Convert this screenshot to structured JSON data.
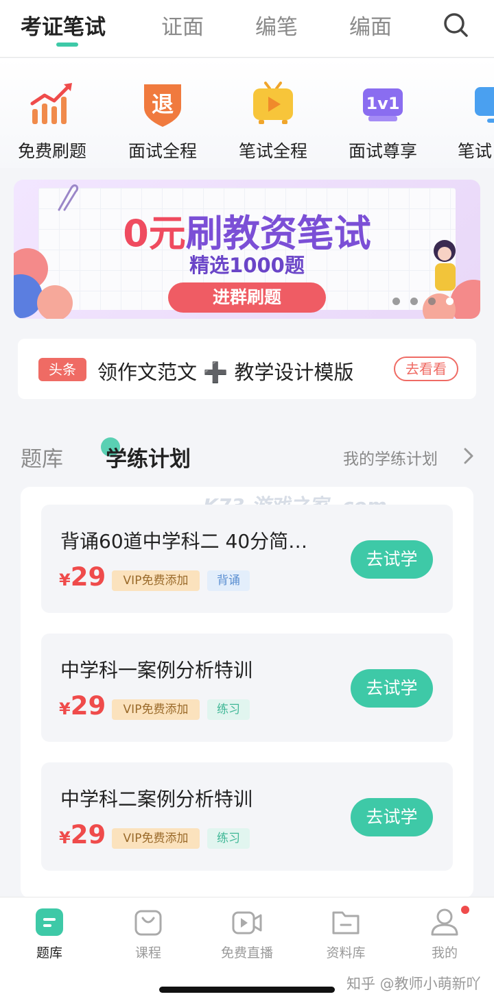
{
  "top_tabs": [
    "考证笔试",
    "证面",
    "编笔",
    "编面"
  ],
  "categories": [
    "免费刷题",
    "面试全程",
    "笔试全程",
    "面试尊享",
    "笔试"
  ],
  "category_icon_glyphs": {
    "refund": "退",
    "one_on_one": "1v1"
  },
  "banner": {
    "title_red": "0元",
    "title_purple": "刷教资笔试",
    "subtitle": "精选1000题",
    "button": "进群刷题"
  },
  "news": {
    "tag": "头条",
    "text": "领作文范文 ➕ 教学设计模版",
    "action": "去看看"
  },
  "sections": {
    "tab1": "题库",
    "tab2": "学练计划",
    "my_plan": "我的学练计划"
  },
  "plans": [
    {
      "title": "背诵60道中学科二 40分简…",
      "currency": "¥",
      "price": "29",
      "vip": "VIP免费添加",
      "kind": "背诵",
      "action": "去试学"
    },
    {
      "title": "中学科一案例分析特训",
      "currency": "¥",
      "price": "29",
      "vip": "VIP免费添加",
      "kind": "练习",
      "action": "去试学"
    },
    {
      "title": "中学科二案例分析特训",
      "currency": "¥",
      "price": "29",
      "vip": "VIP免费添加",
      "kind": "练习",
      "action": "去试学"
    }
  ],
  "bottom_nav": [
    "题库",
    "课程",
    "免费直播",
    "资料库",
    "我的"
  ],
  "watermark": "知乎 @教师小萌新吖",
  "overlay_watermark": "K73 游戏之家 .com",
  "colors": {
    "accent": "#3ec9a7",
    "price": "#ef4b4b",
    "tag": "#ef6b64"
  }
}
